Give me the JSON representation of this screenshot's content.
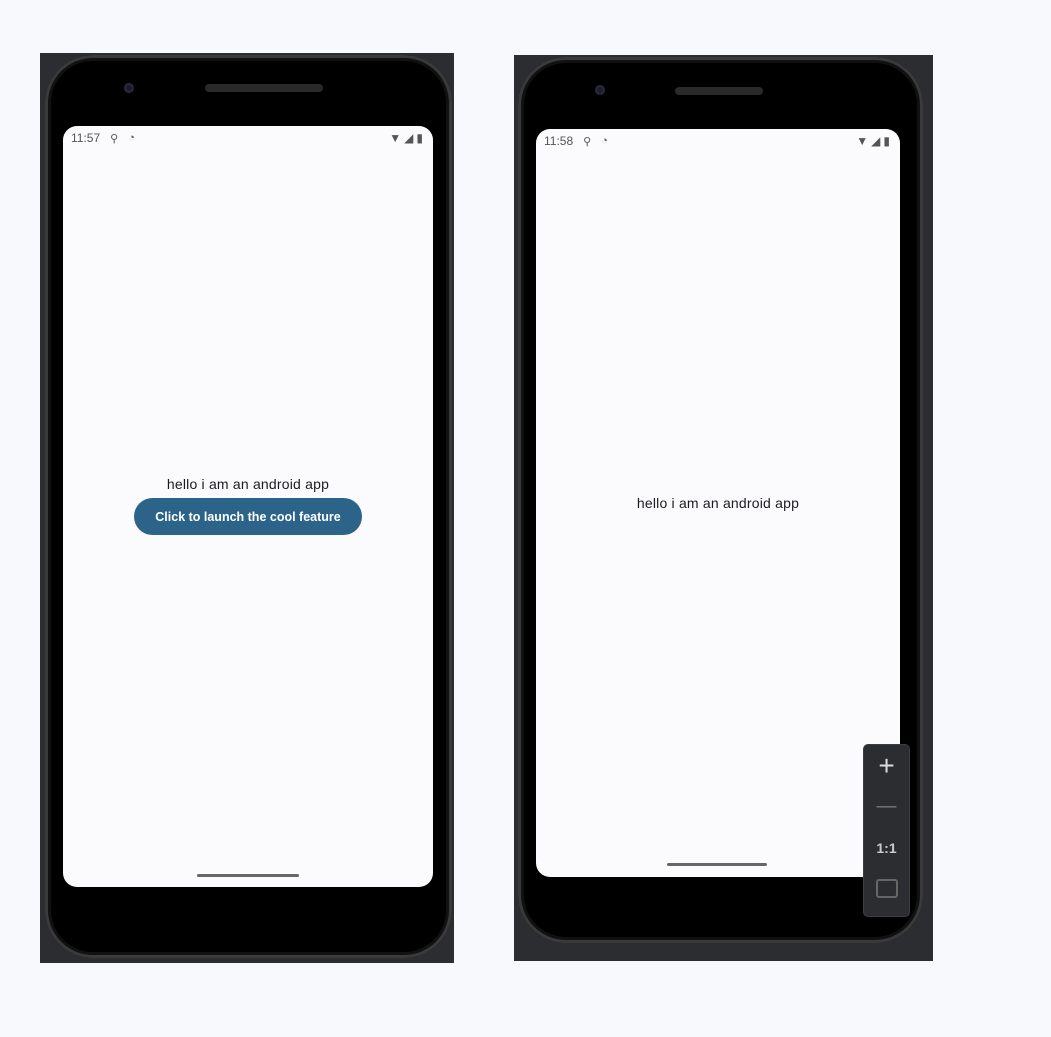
{
  "left_device": {
    "status": {
      "time": "11:57"
    },
    "app": {
      "text": "hello i am an android app",
      "button_label": "Click to launch the cool feature",
      "button_color": "#2b6488"
    }
  },
  "right_device": {
    "status": {
      "time": "11:58"
    },
    "app": {
      "text": "hello i am an android app"
    }
  },
  "zoom_controls": {
    "zoom_in": "+",
    "zoom_out": "—",
    "actual_size": "1:1",
    "fit_icon": "fit-screen-icon"
  }
}
